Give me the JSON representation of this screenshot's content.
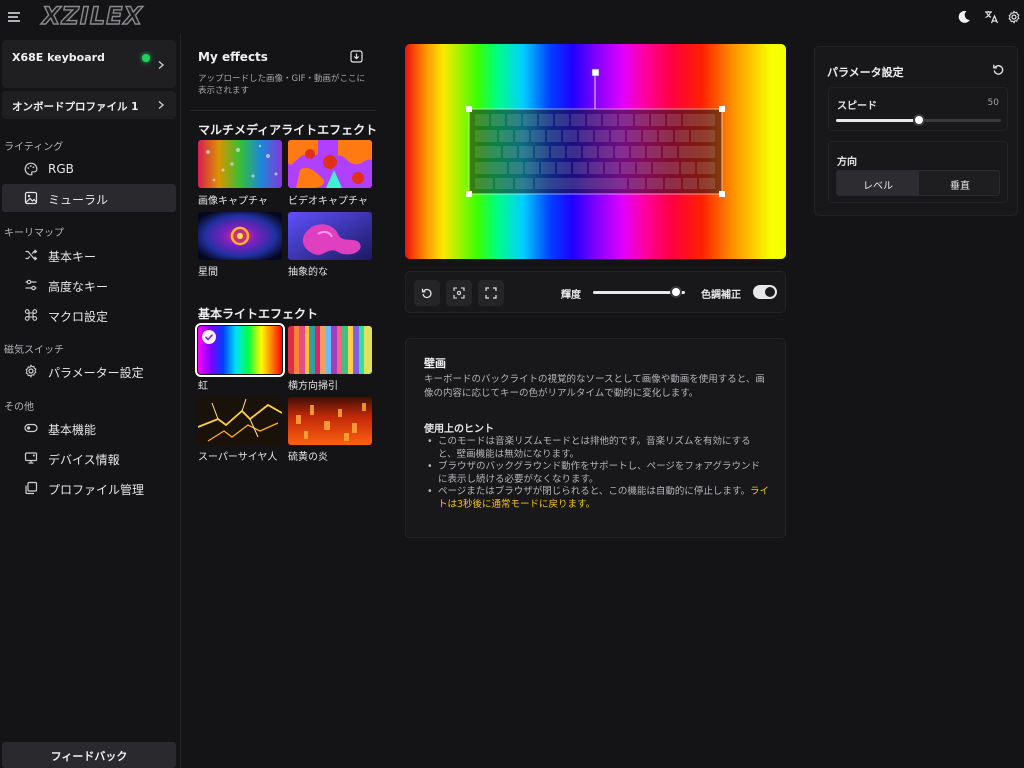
{
  "app": {
    "logo_text": "XZILEX"
  },
  "header": {
    "icons": [
      "menu-icon",
      "moon-icon",
      "translate-icon",
      "gear-icon"
    ]
  },
  "sidebar": {
    "device": {
      "name": "X68E keyboard",
      "connected": true
    },
    "profile": {
      "label": "オンボードプロファイル 1"
    },
    "sections": [
      {
        "label": "ライティング",
        "items": [
          {
            "label": "RGB",
            "icon": "palette-icon"
          },
          {
            "label": "ミューラル",
            "icon": "image-icon",
            "active": true
          }
        ]
      },
      {
        "label": "キーリマップ",
        "items": [
          {
            "label": "基本キー",
            "icon": "shuffle-icon"
          },
          {
            "label": "高度なキー",
            "icon": "sliders-icon"
          },
          {
            "label": "マクロ設定",
            "icon": "command-icon"
          }
        ]
      },
      {
        "label": "磁気スイッチ",
        "items": [
          {
            "label": "パラメーター設定",
            "icon": "gear-icon"
          }
        ]
      },
      {
        "label": "その他",
        "items": [
          {
            "label": "基本機能",
            "icon": "toggle-icon"
          },
          {
            "label": "デバイス情報",
            "icon": "monitor-icon"
          },
          {
            "label": "プロファイル管理",
            "icon": "copy-icon"
          }
        ]
      }
    ],
    "feedback_label": "フィードバック"
  },
  "effects": {
    "my_effects_title": "My effects",
    "upload_hint": "アップロードした画像・GIF・動画がここに表示されます",
    "multimedia": {
      "title": "マルチメディアライトエフェクト",
      "items": [
        "画像キャプチャ",
        "ビデオキャプチャ",
        "星間",
        "抽象的な"
      ]
    },
    "basic": {
      "title": "基本ライトエフェクト",
      "items": [
        "虹",
        "横方向掃引",
        "スーパーサイヤ人",
        "硫黄の炎"
      ],
      "selected": "虹"
    }
  },
  "toolbar": {
    "brightness_label": "輝度",
    "brightness_value": 0.9,
    "color_correction_label": "色調補正",
    "color_correction_on": true
  },
  "info": {
    "title": "壁画",
    "description": "キーボードのバックライトの視覚的なソースとして画像や動画を使用すると、画像の内容に応じてキーの色がリアルタイムで動的に変化します。",
    "hints_title": "使用上のヒント",
    "hint1": "このモードは音楽リズムモードとは排他的です。音楽リズムを有効にすると、壁画機能は無効になります。",
    "hint2": "ブラウザのバックグラウンド動作をサポートし、ページをフォアグラウンドに表示し続ける必要がなくなります。",
    "hint3_prefix": "ページまたはブラウザが閉じられると、この機能は自動的に停止します。",
    "hint3_highlight": "ライトは3秒後に通常モードに戻ります。",
    "highlight_color": "#f2c418"
  },
  "params": {
    "title": "パラメータ設定",
    "speed_label": "スピード",
    "speed_value": "50",
    "speed_fraction": 0.5,
    "direction_label": "方向",
    "direction_options": [
      "レベル",
      "垂直"
    ],
    "direction_selected": "レベル"
  },
  "colors": {
    "accent_green": "#22d35a",
    "background": "#141416",
    "panel": "#18181a"
  }
}
